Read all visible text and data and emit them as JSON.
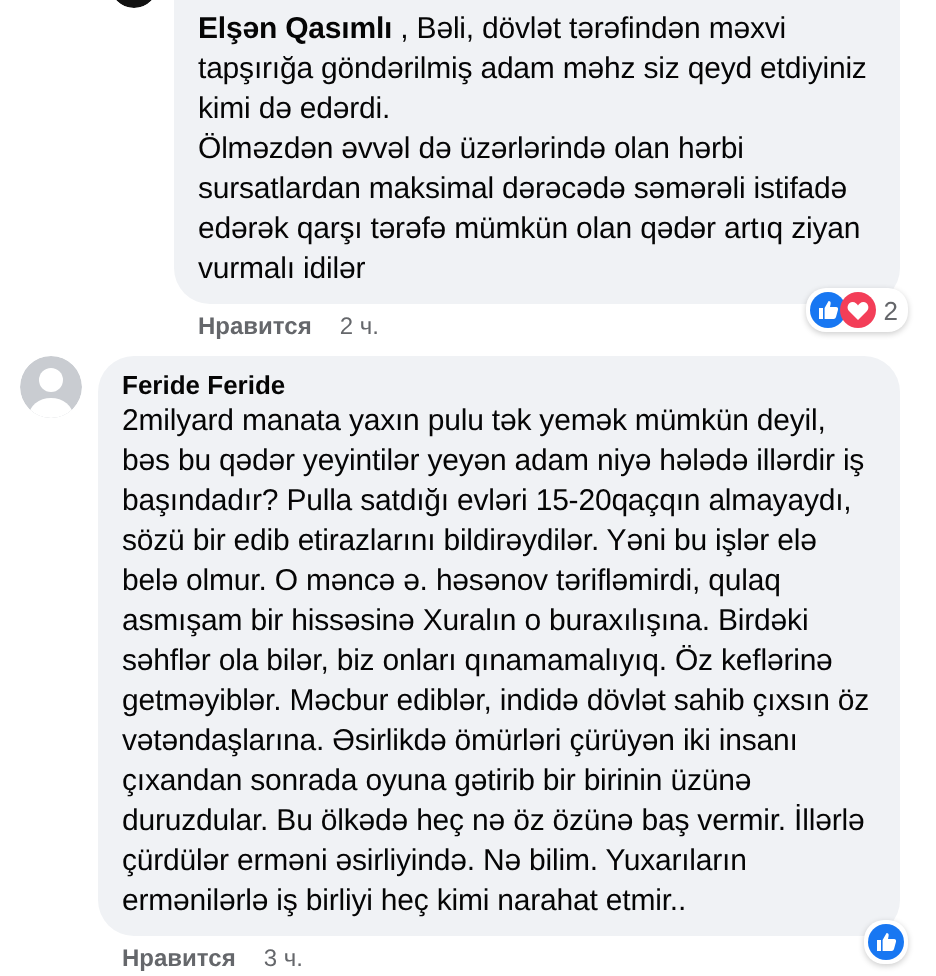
{
  "comments": [
    {
      "text": "**Elşən Qasımlı** , Bəli, dövlət tərəfindən məxvi\ntapşırığa göndərilmiş adam məhz siz qeyd etdiyiniz\nkimi də edərdi.\nÖlməzdən əvvəl də üzərlərində olan hərbi\nsursatlardan maksimal dərəcədə səmərəli istifadə\nedərək qarşı tərəfə mümkün olan qədər artıq ziyan\nvurmalı idilər",
      "like": "Нравится",
      "time": "2 ч.",
      "reaction_count": "2"
    },
    {
      "author": "Feride Feride",
      "text": "2milyard manata yaxın pulu tək yemək mümkün deyil,\nbəs bu qədər yeyintilər yeyən adam niyə hələdə illərdir iş\nbaşındadır? Pulla satdığı evləri 15-20qaçqın almayaydı,\nsözü bir edib etirazlarını bildirəydilər. Yəni bu işlər elə\nbelə olmur. O məncə ə. həsənov tərifləmirdi, qulaq\nasmışam bir hissəsinə Xuralın o buraxılışına. Birdəki\nsəhflər ola bilər, biz onları qınamamalıyıq. Öz keflərinə\ngetməyiblər. Məcbur ediblər, indidə dövlət sahib çıxsın öz\nvətəndaşlarına. Əsirlikdə ömürləri çürüyən iki insanı\nçıxandan sonrada oyuna gətirib bir birinin üzünə\nduruzdular. Bu ölkədə heç nə öz özünə baş vermir. İllərlə\nçürdülər erməni əsirliyində. Nə bilim. Yuxarıların\nermənilərlə iş birliyi heç kimi narahat etmir..",
      "like": "Нравится",
      "time": "3 ч."
    }
  ]
}
